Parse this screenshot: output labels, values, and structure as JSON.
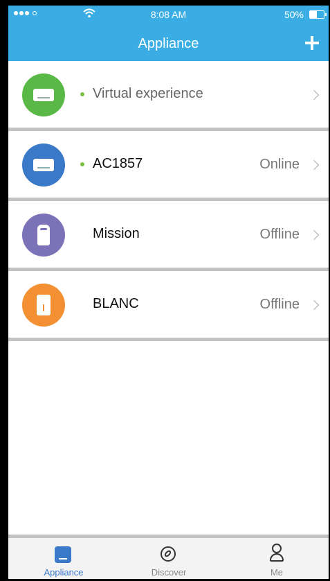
{
  "status_bar": {
    "time": "8:08 AM",
    "battery_percent": "50%",
    "battery_level": 0.5
  },
  "header": {
    "title": "Appliance",
    "add_icon": "plus-icon"
  },
  "colors": {
    "header_bg": "#3aaee4",
    "online_dot": "#7ac143",
    "tab_active": "#3a78c8",
    "avatar_virtual": "#5ab847",
    "avatar_ac": "#3a78c8",
    "avatar_mission": "#7b72b8",
    "avatar_blanc": "#f39033"
  },
  "appliances": [
    {
      "name": "Virtual experience",
      "status": "",
      "online_dot": true,
      "icon": "air-conditioner-icon"
    },
    {
      "name": "AC1857",
      "status": "Online",
      "online_dot": true,
      "icon": "air-conditioner-icon"
    },
    {
      "name": "Mission",
      "status": "Offline",
      "online_dot": false,
      "icon": "air-purifier-icon"
    },
    {
      "name": "BLANC",
      "status": "Offline",
      "online_dot": false,
      "icon": "heater-icon"
    }
  ],
  "tabs": [
    {
      "label": "Appliance",
      "icon": "air-conditioner-icon",
      "active": true
    },
    {
      "label": "Discover",
      "icon": "compass-icon",
      "active": false
    },
    {
      "label": "Me",
      "icon": "person-icon",
      "active": false
    }
  ]
}
